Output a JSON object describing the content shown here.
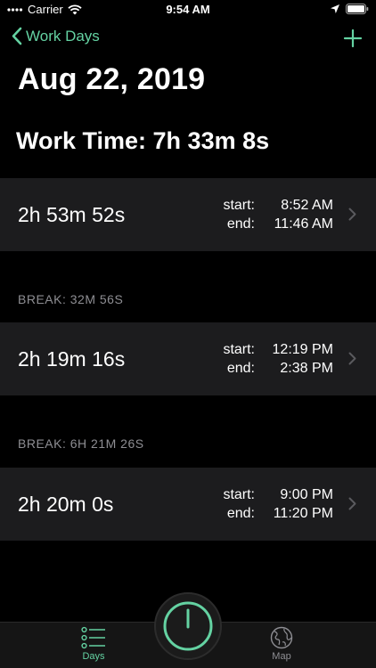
{
  "status_bar": {
    "carrier": "Carrier",
    "time": "9:54 AM",
    "icons": [
      "wifi-icon",
      "location-arrow-icon",
      "battery-icon"
    ]
  },
  "nav": {
    "back_label": "Work Days",
    "add_icon": "plus-icon"
  },
  "page": {
    "title": "Aug 22, 2019",
    "work_time": "Work Time: 7h 33m 8s"
  },
  "sessions": [
    {
      "duration": "2h 53m 52s",
      "start_label": "start:",
      "start": "8:52 AM",
      "end_label": "end:",
      "end": "11:46 AM"
    },
    {
      "duration": "2h 19m 16s",
      "start_label": "start:",
      "start": "12:19 PM",
      "end_label": "end:",
      "end": "2:38 PM"
    },
    {
      "duration": "2h 20m 0s",
      "start_label": "start:",
      "start": "9:00 PM",
      "end_label": "end:",
      "end": "11:20 PM"
    }
  ],
  "breaks": [
    {
      "label": "BREAK: 32M 56S"
    },
    {
      "label": "BREAK: 6H 21M 26S"
    }
  ],
  "tab_bar": {
    "tabs": [
      {
        "label": "Days",
        "icon": "list-icon",
        "selected": true
      },
      {
        "label": "Map",
        "icon": "globe-icon",
        "selected": false
      }
    ],
    "center_icon": "power-icon"
  },
  "colors": {
    "accent": "#64d2a2",
    "background": "#000000",
    "cell": "#1c1c1e",
    "secondary_text": "#8e8e93"
  }
}
